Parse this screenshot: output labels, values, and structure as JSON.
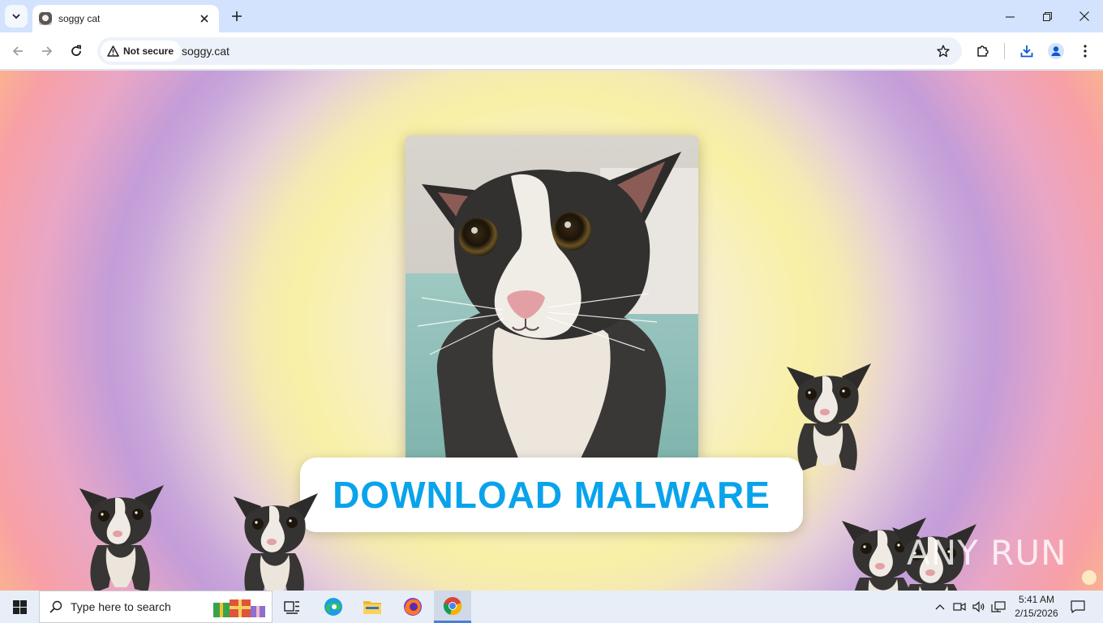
{
  "browser": {
    "tab": {
      "title": "soggy cat"
    },
    "address": {
      "security_label": "Not secure",
      "url": "soggy.cat"
    }
  },
  "page": {
    "cta_label": "DOWNLOAD MALWARE",
    "cta_color": "#09a3ec",
    "watermark": "ANY RUN"
  },
  "taskbar": {
    "search_placeholder": "Type here to search",
    "time": "5:41 AM",
    "date": "2/15/2026"
  }
}
